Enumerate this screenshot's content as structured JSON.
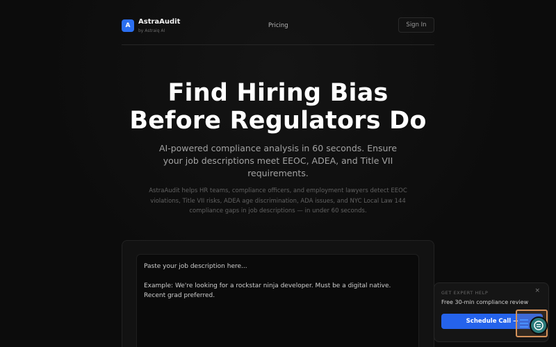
{
  "header": {
    "logo_letter": "A",
    "brand_name": "AstraAudit",
    "brand_sub": "by Astraiq AI",
    "nav_pricing": "Pricing",
    "signin_label": "Sign In"
  },
  "hero": {
    "title_line1": "Find Hiring Bias",
    "title_line2": "Before Regulators Do",
    "subtitle": "AI-powered compliance analysis in 60 seconds. Ensure your job descriptions meet EEOC, ADEA, and Title VII requirements.",
    "description": "AstraAudit helps HR teams, compliance officers, and employment lawyers detect EEOC violations, Title VII risks, ADEA age discrimination, ADA issues, and NYC Local Law 144 compliance gaps in job descriptions — in under 60 seconds."
  },
  "input": {
    "placeholder": "Paste your job description here...\n\nExample: We're looking for a rockstar ninja developer. Must be a digital native. Recent grad preferred."
  },
  "expert_widget": {
    "label": "GET EXPERT HELP",
    "close_symbol": "×",
    "text": "Free 30-min compliance review",
    "button_label": "Schedule Call →"
  },
  "colors": {
    "accent": "#2563eb",
    "logo_bg": "#2b6ff0",
    "background": "#0c0c0c",
    "chat_highlight": "#d6925a",
    "chat_bubble": "#2a7a7a"
  },
  "icons": {
    "chat_launcher": "chat-icon"
  }
}
